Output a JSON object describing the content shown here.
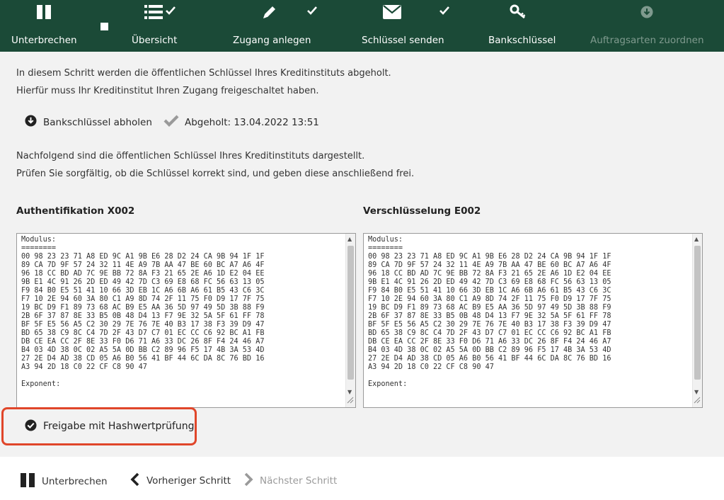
{
  "toolbar": {
    "items": [
      {
        "label": "Unterbrechen",
        "icon": "pause-icon"
      },
      {
        "label": "Übersicht",
        "icon": "list-icon",
        "done": true
      },
      {
        "label": "Zugang anlegen",
        "icon": "pencil-icon",
        "done": true
      },
      {
        "label": "Schlüssel senden",
        "icon": "envelope-icon",
        "done": true
      },
      {
        "label": "Bankschlüssel",
        "icon": "key-icon"
      },
      {
        "label": "Auftragsarten zuordnen",
        "icon": "download-circle-icon",
        "disabled": true
      }
    ]
  },
  "intro": {
    "line1": "In diesem Schritt werden die öffentlichen Schlüssel Ihres Kreditinstituts abgeholt.",
    "line2": "Hierfür muss Ihr Kreditinstitut Ihren Zugang freigeschaltet haben."
  },
  "fetch": {
    "button_label": "Bankschlüssel abholen",
    "status_label": "Abgeholt: 13.04.2022 13:51"
  },
  "instructions": {
    "line1": "Nachfolgend sind die öffentlichen Schlüssel Ihres Kreditinstituts dargestellt.",
    "line2": "Prüfen Sie sorgfältig, ob die Schlüssel korrekt sind, und geben diese anschließend frei."
  },
  "keys": {
    "auth_title": "Authentifikation X002",
    "enc_title": "Verschlüsselung E002",
    "auth_text": "Modulus:\n========\n00 98 23 23 71 A8 ED 9C A1 9B E6 28 D2 24 CA 9B 94 1F 1F\n89 CA 7D 9F 57 24 32 11 4E A9 7B AA 47 BE 60 BC A7 A6 4F\n96 18 CC BD AD 7C 9E BB 72 8A F3 21 65 2E A6 1D E2 04 EE\n9B E1 4C 91 26 2D ED 49 42 7D C3 69 E8 68 FC 56 63 13 05\nF9 84 B0 E5 51 41 10 66 3D EB 1C A6 6B A6 61 B5 43 C6 3C\nF7 10 2E 94 60 3A 80 C1 A9 8D 74 2F 11 75 F0 D9 17 7F 75\n19 BC D9 F1 89 73 68 AC B9 E5 AA 36 5D 97 49 5D 3B 88 F9\n2B 6F 37 87 8E 33 B5 0B 48 D4 13 F7 9E 32 5A 5F 61 FF 78\nBF 5F E5 56 A5 C2 30 29 7E 76 7E 40 B3 17 38 F3 39 D9 47\nBD 65 38 C9 8C C4 7D 2F 43 D7 C7 01 EC CC C6 92 BC A1 FB\nDB CE EA CC 2F 8E 33 F0 D6 71 A6 33 DC 26 8F F4 24 46 A7\nB4 03 4D 38 0C 02 A5 5A 0D BB C2 89 96 F5 17 4B 3A 53 4D\n27 2E D4 AD 38 CD 05 A6 B0 56 41 BF 44 6C DA 8C 76 BD 16\nA3 94 2D 18 C0 22 CF C8 90 47\n\nExponent:",
    "enc_text": "Modulus:\n========\n00 98 23 23 71 A8 ED 9C A1 9B E6 28 D2 24 CA 9B 94 1F 1F\n89 CA 7D 9F 57 24 32 11 4E A9 7B AA 47 BE 60 BC A7 A6 4F\n96 18 CC BD AD 7C 9E BB 72 8A F3 21 65 2E A6 1D E2 04 EE\n9B E1 4C 91 26 2D ED 49 42 7D C3 69 E8 68 FC 56 63 13 05\nF9 84 B0 E5 51 41 10 66 3D EB 1C A6 6B A6 61 B5 43 C6 3C\nF7 10 2E 94 60 3A 80 C1 A9 8D 74 2F 11 75 F0 D9 17 7F 75\n19 BC D9 F1 89 73 68 AC B9 E5 AA 36 5D 97 49 5D 3B 88 F9\n2B 6F 37 87 8E 33 B5 0B 48 D4 13 F7 9E 32 5A 5F 61 FF 78\nBF 5F E5 56 A5 C2 30 29 7E 76 7E 40 B3 17 38 F3 39 D9 47\nBD 65 38 C9 8C C4 7D 2F 43 D7 C7 01 EC CC C6 92 BC A1 FB\nDB CE EA CC 2F 8E 33 F0 D6 71 A6 33 DC 26 8F F4 24 46 A7\nB4 03 4D 38 0C 02 A5 5A 0D BB C2 89 96 F5 17 4B 3A 53 4D\n27 2E D4 AD 38 CD 05 A6 B0 56 41 BF 44 6C DA 8C 76 BD 16\nA3 94 2D 18 C0 22 CF C8 90 47\n\nExponent:"
  },
  "release": {
    "label": "Freigabe mit Hashwertprüfung"
  },
  "footer": {
    "pause_label": "Unterbrechen",
    "prev_label": "Vorheriger Schritt",
    "next_label": "Nächster Schritt"
  },
  "colors": {
    "toolbar_bg": "#1b4a37",
    "content_bg": "#f2f2f2",
    "highlight": "#e0462a"
  }
}
